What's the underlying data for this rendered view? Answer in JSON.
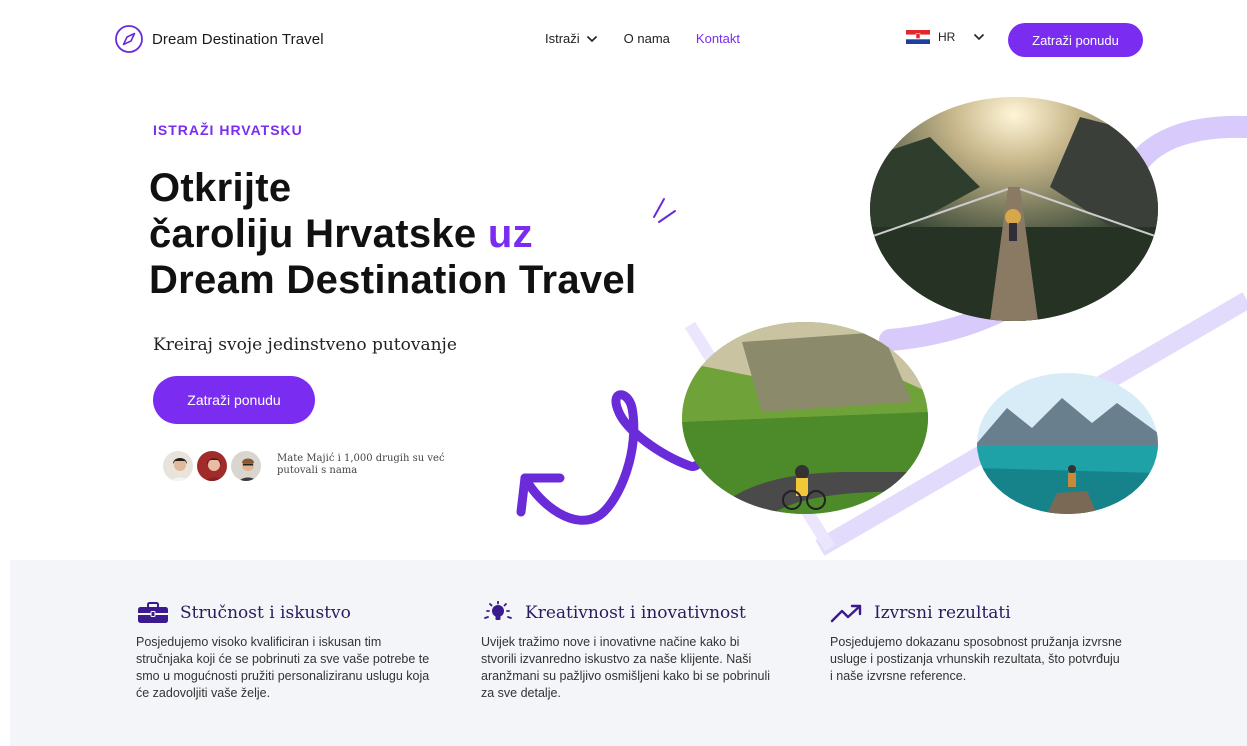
{
  "nav": {
    "brand": "Dream Destination Travel",
    "menu": {
      "explore": "Istraži",
      "about": "O nama",
      "contact": "Kontakt"
    },
    "language": "HR",
    "cta": "Zatraži ponudu"
  },
  "hero": {
    "eyebrow": "ISTRAŽI HRVATSKU",
    "title_line1": "Otkrijte",
    "title_line2_a": "čaroliju Hrvatske ",
    "title_line2_b": "uz",
    "title_line3": "Dream Destination Travel",
    "subtitle": "Kreiraj svoje jedinstveno putovanje",
    "cta": "Zatraži ponudu",
    "social_proof": "Mate Majić i 1,000 drugih su već putovali s nama"
  },
  "features": [
    {
      "icon": "briefcase-icon",
      "title": "Stručnost i iskustvo",
      "text": "Posjedujemo visoko kvalificiran i iskusan tim stručnjaka koji će se pobrinuti za sve vaše potrebe te smo u mogućnosti pružiti personaliziranu uslugu koja će zadovoljiti vaše želje."
    },
    {
      "icon": "lightbulb-icon",
      "title": "Kreativnost i inovativnost",
      "text": "Uvijek tražimo nove i inovativne načine kako bi stvorili izvanredno iskustvo za naše klijente. Naši aranžmani su pažljivo osmišljeni kako bi se pobrinuli za sve detalje."
    },
    {
      "icon": "trending-up-icon",
      "title": "Izvrsni rezultati",
      "text": "Posjedujemo dokazanu sposobnost pružanja izvrsne usluge i postizanja vrhunskih rezultata, što potvrđuju i naše izvrsne reference."
    }
  ],
  "colors": {
    "accent": "#7a2df0",
    "accent_light": "#d9ccfb",
    "feature_bg": "#f4f5f8"
  }
}
